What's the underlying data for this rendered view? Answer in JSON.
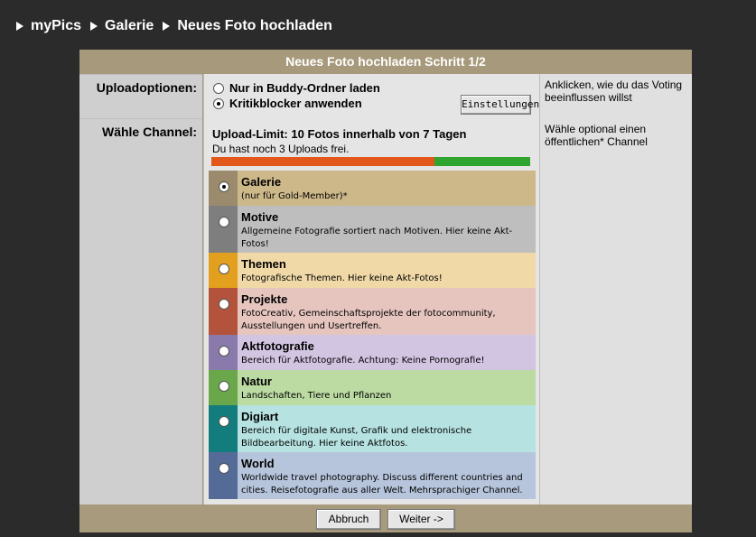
{
  "breadcrumb": [
    "myPics",
    "Galerie",
    "Neues Foto hochladen"
  ],
  "panel": {
    "title": "Neues Foto hochladen Schritt 1/2"
  },
  "upload_options": {
    "label": "Uploadoptionen:",
    "options": [
      {
        "label": "Nur in Buddy-Ordner laden",
        "selected": false
      },
      {
        "label": "Kritikblocker anwenden",
        "selected": true
      }
    ],
    "settings_button": "Einstellungen",
    "hint": "Anklicken, wie du das Voting beeinflussen willst"
  },
  "channel": {
    "label": "Wähle Channel:",
    "hint": "Wähle optional einen öffentlichen* Channel",
    "limit_text": "Upload-Limit: 10 Fotos innerhalb von 7 Tagen",
    "remaining_text": "Du hast noch 3 Uploads frei.",
    "usage_fraction": 0.7,
    "usage_color": "#e2581b",
    "remaining_color": "#2fa52f",
    "items": [
      {
        "title": "Galerie",
        "desc": "(nur für Gold-Member)*",
        "color": "#9b8b6c",
        "bg": "#cdb88a",
        "selected": true
      },
      {
        "title": "Motive",
        "desc": "Allgemeine Fotografie sortiert nach Motiven. Hier keine Akt-Fotos!",
        "color": "#7e7e7e",
        "bg": "#bebebe",
        "selected": false
      },
      {
        "title": "Themen",
        "desc": "Fotografische Themen. Hier keine Akt-Fotos!",
        "color": "#e39f1e",
        "bg": "#f0d9a7",
        "selected": false
      },
      {
        "title": "Projekte",
        "desc": "FotoCreativ, Gemeinschaftsprojekte der fotocommunity, Ausstellungen und Usertreffen.",
        "color": "#b4533c",
        "bg": "#e6c5bf",
        "selected": false
      },
      {
        "title": "Aktfotografie",
        "desc": "Bereich für Aktfotografie. Achtung: Keine Pornografie!",
        "color": "#8a79ab",
        "bg": "#d2c5e2",
        "selected": false
      },
      {
        "title": "Natur",
        "desc": "Landschaften, Tiere und Pflanzen",
        "color": "#6aa64a",
        "bg": "#bcdba3",
        "selected": false
      },
      {
        "title": "Digiart",
        "desc": "Bereich für digitale Kunst, Grafik und elektronische Bildbearbeitung. Hier keine Aktfotos.",
        "color": "#127d7c",
        "bg": "#b6e2e1",
        "selected": false
      },
      {
        "title": "World",
        "desc": "Worldwide travel photography. Discuss different countries and cities. Reisefotografie aus aller Welt. Mehrsprachiger Channel.",
        "color": "#546b97",
        "bg": "#b7c5dc",
        "selected": false
      }
    ]
  },
  "footer": {
    "cancel": "Abbruch",
    "next": "Weiter ->"
  }
}
